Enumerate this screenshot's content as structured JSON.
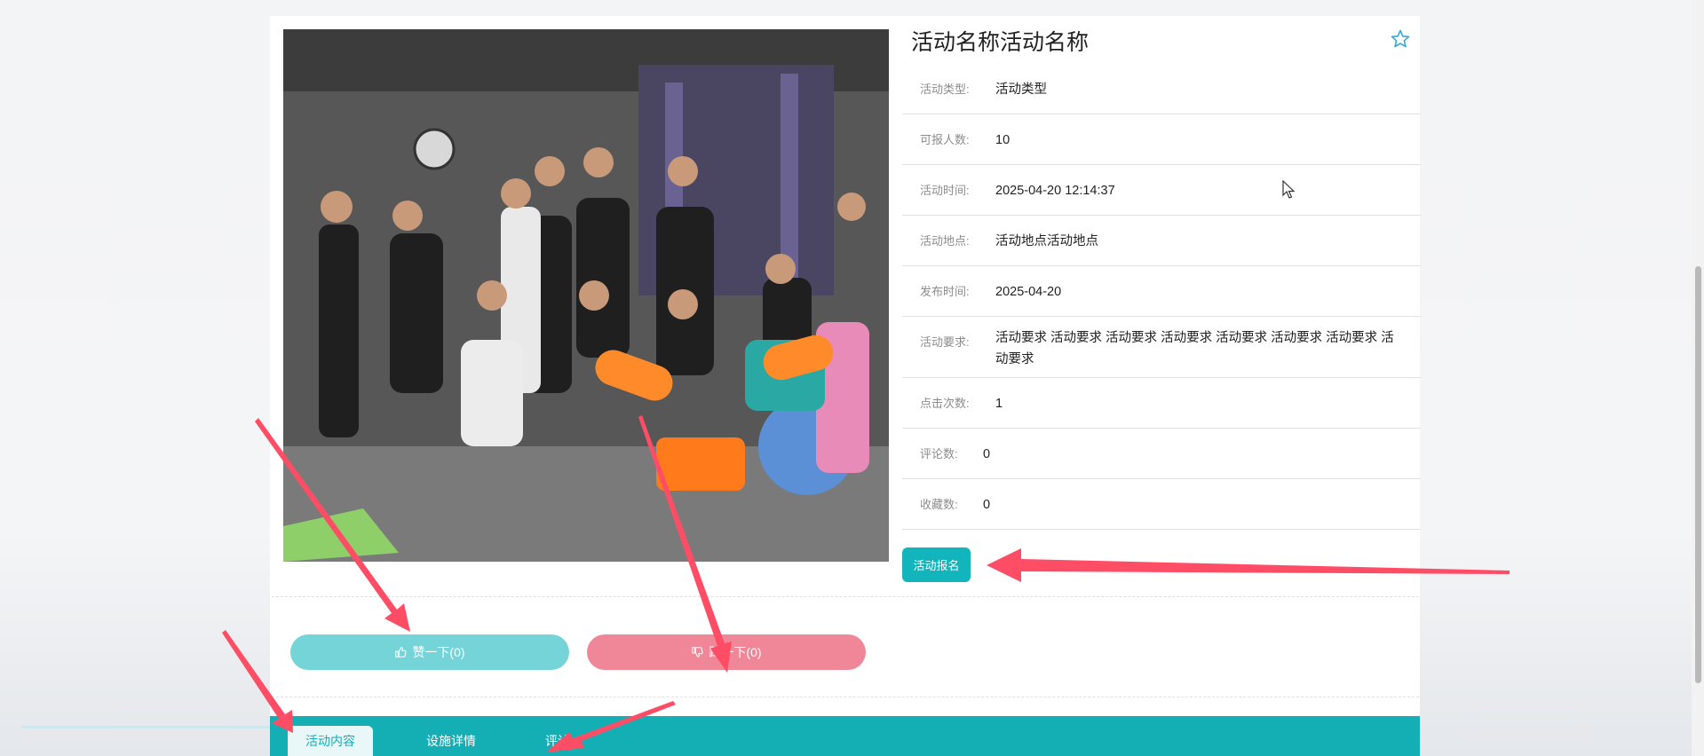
{
  "activity": {
    "title": "活动名称活动名称",
    "fields": [
      {
        "label": "活动类型:",
        "value": "活动类型"
      },
      {
        "label": "可报人数:",
        "value": "10"
      },
      {
        "label": "活动时间:",
        "value": "2025-04-20 12:14:37"
      },
      {
        "label": "活动地点:",
        "value": "活动地点活动地点"
      },
      {
        "label": "发布时间:",
        "value": "2025-04-20"
      },
      {
        "label": "活动要求:",
        "value": "活动要求 活动要求 活动要求 活动要求 活动要求 活动要求 活动要求 活动要求"
      },
      {
        "label": "点击次数:",
        "value": "1"
      },
      {
        "label": "评论数:",
        "value": "0"
      },
      {
        "label": "收藏数:",
        "value": "0"
      }
    ]
  },
  "actions": {
    "signup_label": "活动报名",
    "like_label": "赞一下(0)",
    "dislike_label": "踩一下(0)"
  },
  "tabs": [
    {
      "label": "活动内容",
      "active": true
    },
    {
      "label": "设施详情",
      "active": false
    },
    {
      "label": "评论",
      "active": false
    }
  ],
  "colors": {
    "accent": "#14aeb5",
    "like": "#74d4d8",
    "dislike": "#f08799",
    "annotation_arrow": "#ff4d66"
  },
  "icons": [
    "star-outline-icon",
    "thumb-up-icon",
    "thumb-down-icon"
  ]
}
